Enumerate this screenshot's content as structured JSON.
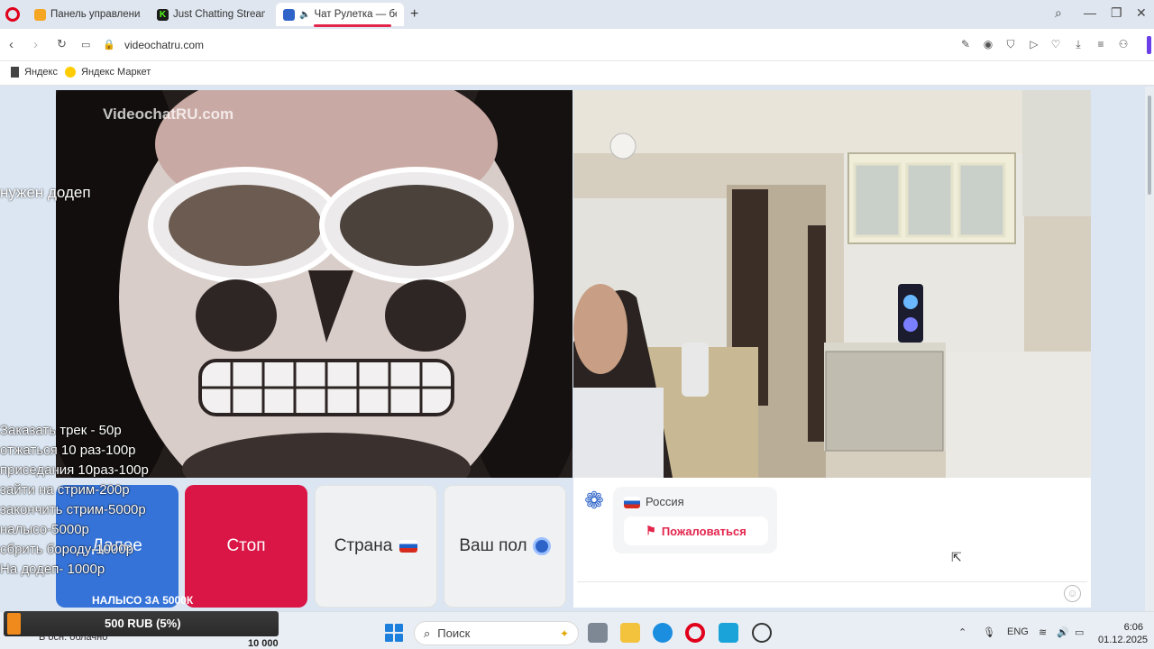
{
  "browser": {
    "tabs": [
      {
        "label": "Панель управления - Do",
        "icon": "donationalerts-icon",
        "color": "#f5a623"
      },
      {
        "label": "Just Chatting Streaming -",
        "icon": "kick-icon",
        "color": "#53fc18"
      },
      {
        "label": "Чат Рулетка — беспл",
        "icon": "videochat-icon",
        "color": "#2e64c8"
      }
    ],
    "url": "videochatru.com",
    "bookmarks": [
      "Яндекс",
      "Яндекс Маркет"
    ]
  },
  "stream_overlay": {
    "watermark": "VideochatRU.com",
    "top_text": "нужен додеп",
    "menu": [
      "Заказать трек - 50р",
      "отжаться 10 раз-100р",
      "приседания 10раз-100р",
      "зайти на стрим-200р",
      "закончить стрим-5000р",
      "налысо-5000р",
      "сбрить бороду-1000р",
      "На додеп- 1000р"
    ],
    "banner": "НАЛЫСО ЗА 5000К",
    "donation_amount": "500 RUB (5%)",
    "donation_goal": "10 000",
    "donation_progress_pct": 5,
    "weather": "В осн. облачно"
  },
  "controls": {
    "next": "Далее",
    "stop": "Стоп",
    "country": "Страна",
    "gender": "Ваш пол"
  },
  "chat": {
    "country": "Россия",
    "report": "Пожаловаться"
  },
  "taskbar": {
    "search_placeholder": "Поиск",
    "lang": "ENG",
    "time": "6:06",
    "date": "01.12.2025"
  },
  "colors": {
    "next": "#3573d8",
    "stop": "#d91646",
    "report": "#e3254c"
  }
}
